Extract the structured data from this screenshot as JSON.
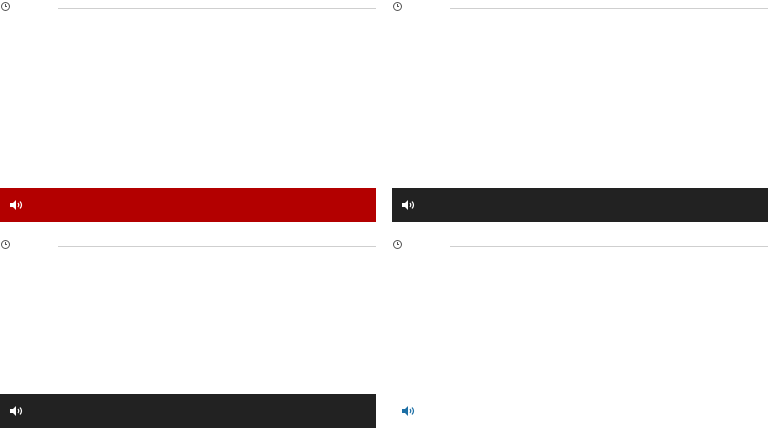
{
  "colors": {
    "audio_bar_red": "#b30000",
    "audio_bar_dark": "#222222",
    "speaker_white": "#ffffff",
    "speaker_teal": "#1d6fa5",
    "rule": "#cfcfcf"
  },
  "cards": [
    {
      "time": "",
      "audio_style": "red",
      "icon": "speaker-icon"
    },
    {
      "time": "",
      "audio_style": "dark",
      "icon": "speaker-icon"
    },
    {
      "time": "",
      "audio_style": "dark",
      "icon": "speaker-icon"
    },
    {
      "time": "",
      "audio_style": "none",
      "icon": "speaker-icon"
    }
  ]
}
